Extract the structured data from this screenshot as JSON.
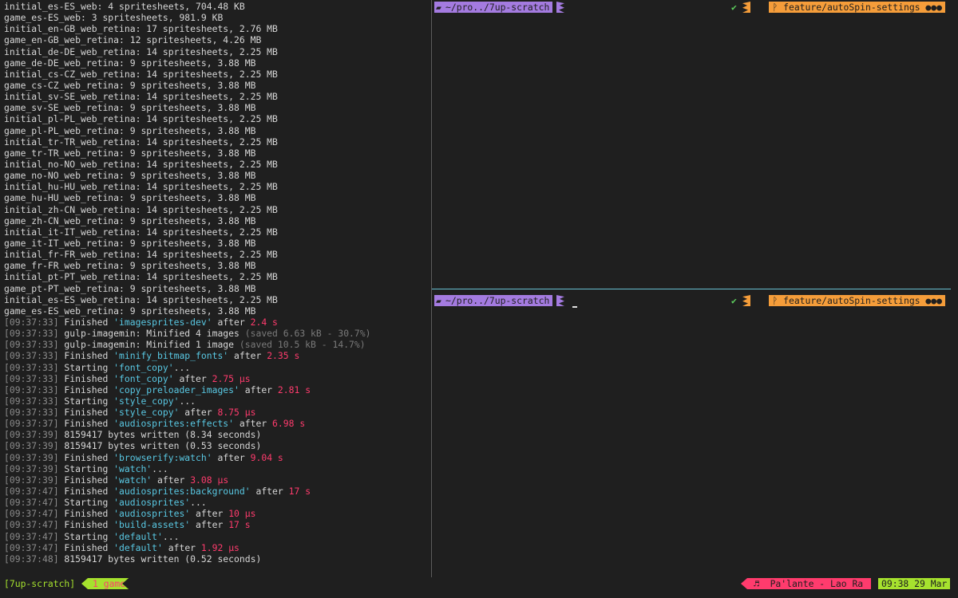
{
  "left_lines": [
    {
      "t": "initial_es-ES_web: 4 spritesheets, 704.48 KB"
    },
    {
      "t": "game_es-ES_web: 3 spritesheets, 981.9 KB"
    },
    {
      "t": "initial_en-GB_web_retina: 17 spritesheets, 2.76 MB"
    },
    {
      "t": "game_en-GB_web_retina: 12 spritesheets, 4.26 MB"
    },
    {
      "t": "initial_de-DE_web_retina: 14 spritesheets, 2.25 MB"
    },
    {
      "t": "game_de-DE_web_retina: 9 spritesheets, 3.88 MB"
    },
    {
      "t": "initial_cs-CZ_web_retina: 14 spritesheets, 2.25 MB"
    },
    {
      "t": "game_cs-CZ_web_retina: 9 spritesheets, 3.88 MB"
    },
    {
      "t": "initial_sv-SE_web_retina: 14 spritesheets, 2.25 MB"
    },
    {
      "t": "game_sv-SE_web_retina: 9 spritesheets, 3.88 MB"
    },
    {
      "t": "initial_pl-PL_web_retina: 14 spritesheets, 2.25 MB"
    },
    {
      "t": "game_pl-PL_web_retina: 9 spritesheets, 3.88 MB"
    },
    {
      "t": "initial_tr-TR_web_retina: 14 spritesheets, 2.25 MB"
    },
    {
      "t": "game_tr-TR_web_retina: 9 spritesheets, 3.88 MB"
    },
    {
      "t": "initial_no-NO_web_retina: 14 spritesheets, 2.25 MB"
    },
    {
      "t": "game_no-NO_web_retina: 9 spritesheets, 3.88 MB"
    },
    {
      "t": "initial_hu-HU_web_retina: 14 spritesheets, 2.25 MB"
    },
    {
      "t": "game_hu-HU_web_retina: 9 spritesheets, 3.88 MB"
    },
    {
      "t": "initial_zh-CN_web_retina: 14 spritesheets, 2.25 MB"
    },
    {
      "t": "game_zh-CN_web_retina: 9 spritesheets, 3.88 MB"
    },
    {
      "t": "initial_it-IT_web_retina: 14 spritesheets, 2.25 MB"
    },
    {
      "t": "game_it-IT_web_retina: 9 spritesheets, 3.88 MB"
    },
    {
      "t": "initial_fr-FR_web_retina: 14 spritesheets, 2.25 MB"
    },
    {
      "t": "game_fr-FR_web_retina: 9 spritesheets, 3.88 MB"
    },
    {
      "t": "initial_pt-PT_web_retina: 14 spritesheets, 2.25 MB"
    },
    {
      "t": "game_pt-PT_web_retina: 9 spritesheets, 3.88 MB"
    },
    {
      "t": "initial_es-ES_web_retina: 14 spritesheets, 2.25 MB"
    },
    {
      "t": "game_es-ES_web_retina: 9 spritesheets, 3.88 MB"
    },
    {
      "ts": "[09:37:33]",
      "pre": " Finished ",
      "q": "'imagesprites-dev'",
      "mid": " after ",
      "num": "2.4 s"
    },
    {
      "ts": "[09:37:33]",
      "pre": " gulp-imagemin: Minified 4 images ",
      "dim": "(saved 6.63 kB - 30.7%)"
    },
    {
      "ts": "[09:37:33]",
      "pre": " gulp-imagemin: Minified 1 image ",
      "dim": "(saved 10.5 kB - 14.7%)"
    },
    {
      "ts": "[09:37:33]",
      "pre": " Finished ",
      "q": "'minify_bitmap_fonts'",
      "mid": " after ",
      "num": "2.35 s"
    },
    {
      "ts": "[09:37:33]",
      "pre": " Starting ",
      "q": "'font_copy'",
      "mid": "..."
    },
    {
      "ts": "[09:37:33]",
      "pre": " Finished ",
      "q": "'font_copy'",
      "mid": " after ",
      "num": "2.75 μs"
    },
    {
      "ts": "[09:37:33]",
      "pre": " Finished ",
      "q": "'copy_preloader_images'",
      "mid": " after ",
      "num": "2.81 s"
    },
    {
      "ts": "[09:37:33]",
      "pre": " Starting ",
      "q": "'style_copy'",
      "mid": "..."
    },
    {
      "ts": "[09:37:33]",
      "pre": " Finished ",
      "q": "'style_copy'",
      "mid": " after ",
      "num": "8.75 μs"
    },
    {
      "ts": "[09:37:37]",
      "pre": " Finished ",
      "q": "'audiosprites:effects'",
      "mid": " after ",
      "num": "6.98 s"
    },
    {
      "ts": "[09:37:39]",
      "pre": " 8159417 bytes written (8.34 seconds)"
    },
    {
      "ts": "[09:37:39]",
      "pre": " 8159417 bytes written (0.53 seconds)"
    },
    {
      "ts": "[09:37:39]",
      "pre": " Finished ",
      "q": "'browserify:watch'",
      "mid": " after ",
      "num": "9.04 s"
    },
    {
      "ts": "[09:37:39]",
      "pre": " Starting ",
      "q": "'watch'",
      "mid": "..."
    },
    {
      "ts": "[09:37:39]",
      "pre": " Finished ",
      "q": "'watch'",
      "mid": " after ",
      "num": "3.08 μs"
    },
    {
      "ts": "[09:37:47]",
      "pre": " Finished ",
      "q": "'audiosprites:background'",
      "mid": " after ",
      "num": "17 s"
    },
    {
      "ts": "[09:37:47]",
      "pre": " Starting ",
      "q": "'audiosprites'",
      "mid": "..."
    },
    {
      "ts": "[09:37:47]",
      "pre": " Finished ",
      "q": "'audiosprites'",
      "mid": " after ",
      "num": "10 μs"
    },
    {
      "ts": "[09:37:47]",
      "pre": " Finished ",
      "q": "'build-assets'",
      "mid": " after ",
      "num": "17 s"
    },
    {
      "ts": "[09:37:47]",
      "pre": " Starting ",
      "q": "'default'",
      "mid": "..."
    },
    {
      "ts": "[09:37:47]",
      "pre": " Finished ",
      "q": "'default'",
      "mid": " after ",
      "num": "1.92 μs"
    },
    {
      "ts": "[09:37:48]",
      "pre": " 8159417 bytes written (0.52 seconds)"
    }
  ],
  "prompt": {
    "dir": "~/pro../7up-scratch",
    "branch": "feature/autoSpin-settings",
    "status_glyphs": "●●●",
    "folder_icon": "folder-icon",
    "check_icon": "check-icon",
    "branch_icon": "git-branch-icon"
  },
  "statusbar": {
    "session": "[7up-scratch]",
    "window": "1 game",
    "music_icon": "music-note-icon",
    "now_playing": "Pa'lante - Lao Ra",
    "clock": "09:38 29 Mar"
  },
  "colors": {
    "background": "#1f1f1f",
    "purple": "#a47be0",
    "orange": "#f59d3a",
    "green": "#a6e22e",
    "pink": "#ff3b6d",
    "cyan": "#59c8e3"
  }
}
